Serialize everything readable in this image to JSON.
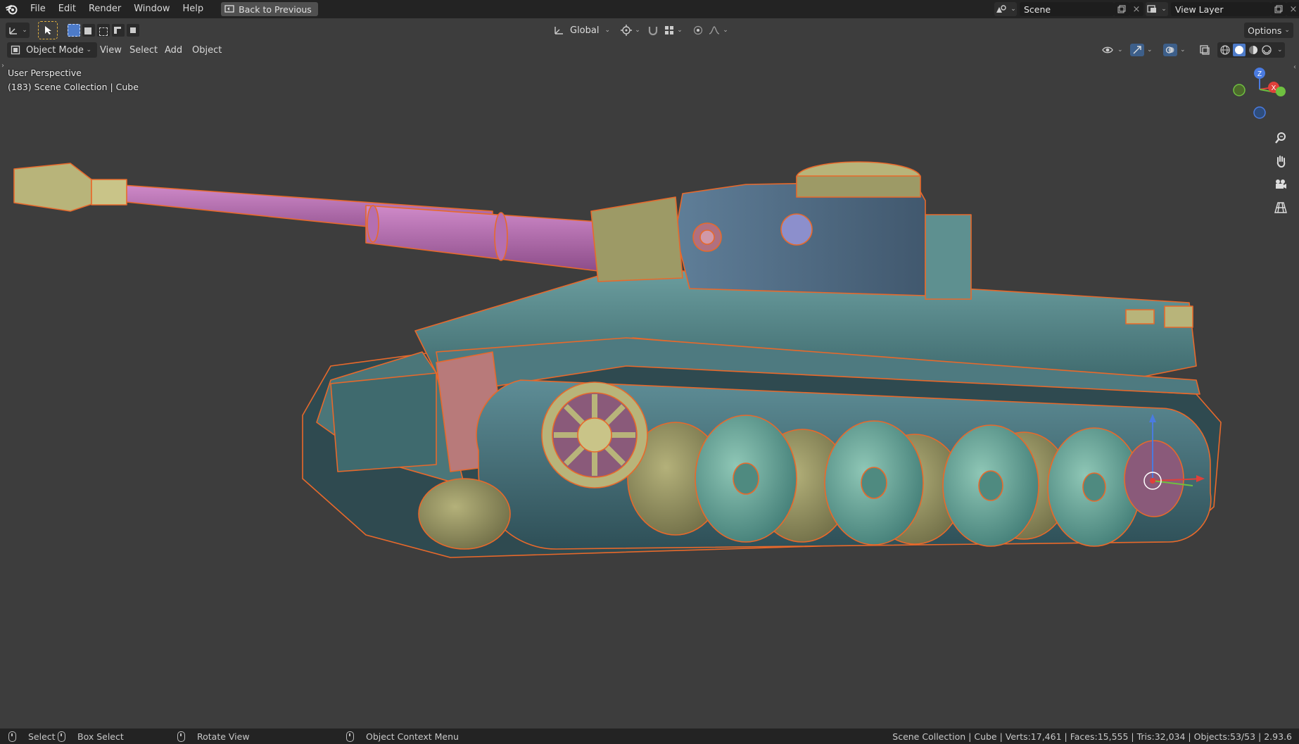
{
  "menubar": {
    "items": [
      "File",
      "Edit",
      "Render",
      "Window",
      "Help"
    ],
    "back_button": "Back to Previous",
    "scene_label": "Scene",
    "view_layer_label": "View Layer"
  },
  "toolbar": {
    "transform_orientation": "Global",
    "options_label": "Options"
  },
  "header": {
    "mode": "Object Mode",
    "menus": [
      "View",
      "Select",
      "Add",
      "Object"
    ]
  },
  "viewport": {
    "perspective": "User Perspective",
    "collection_info": "(183) Scene Collection | Cube",
    "gizmo_axes": [
      "Z",
      "X"
    ]
  },
  "statusbar": {
    "select": "Select",
    "box_select": "Box Select",
    "rotate_view": "Rotate View",
    "context_menu": "Object Context Menu",
    "stats": "Scene Collection | Cube | Verts:17,461 | Faces:15,555 | Tris:32,034 | Objects:53/53 | 2.93.6"
  },
  "colors": {
    "outline": "#e8692b",
    "hull": "#5e8f91",
    "barrel": "#b56fb0",
    "brass": "#b8b47a",
    "wheel": "#68a699",
    "turret": "#5a7690",
    "pink": "#b87a7a"
  }
}
